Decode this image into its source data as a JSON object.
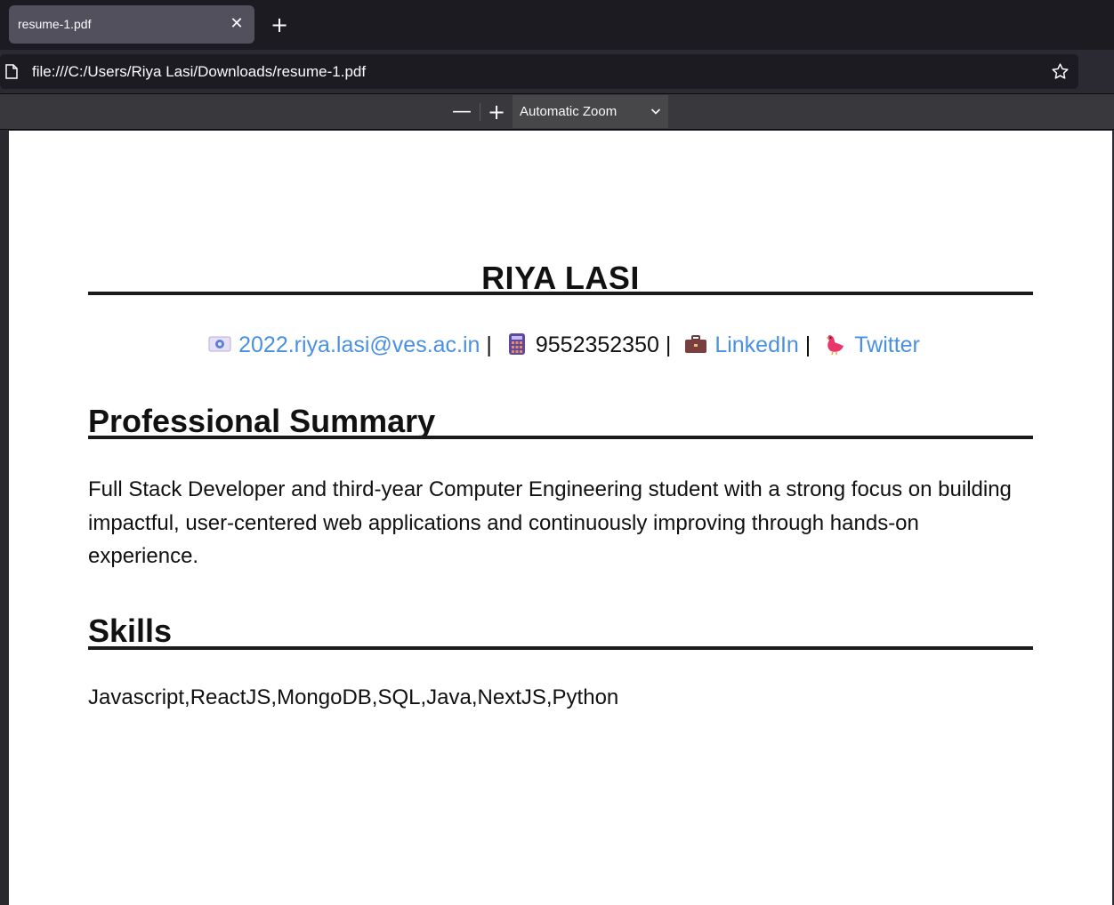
{
  "browser": {
    "tab_title": "resume-1.pdf",
    "tab_close": "✕",
    "new_tab": "+",
    "url": "file:///C:/Users/Riya Lasi/Downloads/resume-1.pdf"
  },
  "pdf_toolbar": {
    "zoom_out": "—",
    "zoom_in": "+",
    "zoom_value": "Automatic Zoom"
  },
  "resume": {
    "name": "RIYA LASI",
    "contact": {
      "email": "2022.riya.lasi@ves.ac.in",
      "phone": "9552352350",
      "linkedin": "LinkedIn",
      "twitter": "Twitter",
      "separator": "|"
    },
    "summary_heading": "Professional Summary",
    "summary_text": "Full Stack Developer and third-year Computer Engineering student with a strong focus on building impactful, user-centered web applications and continuously improving through hands-on experience.",
    "skills_heading": "Skills",
    "skills_text": "Javascript,ReactJS,MongoDB,SQL,Java,NextJS,Python"
  },
  "colors": {
    "link": "#4a90e2",
    "tab_bg": "#52505c",
    "toolbar_bg": "#38383d"
  },
  "icons": {
    "email": "envelope-icon",
    "phone": "calculator-icon",
    "linkedin": "briefcase-icon",
    "twitter": "bird-icon"
  }
}
